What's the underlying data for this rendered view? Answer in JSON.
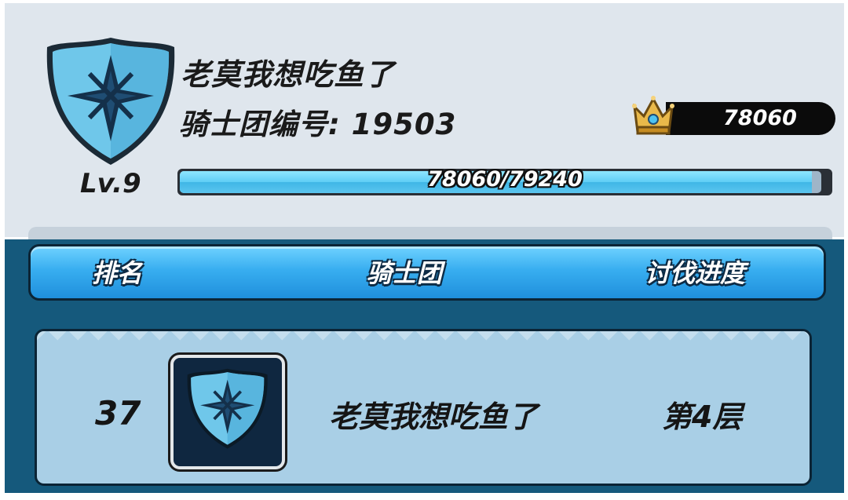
{
  "profile": {
    "guild_name": "老莫我想吃鱼了",
    "guild_id_label": "骑士团编号: 19503",
    "level": "Lv.9",
    "crown_score": "78060",
    "xp_text": "78060/79240",
    "xp_fraction": 0.985,
    "emblem_icon": "shield-star-icon"
  },
  "table": {
    "headers": {
      "rank": "排名",
      "guild": "骑士团",
      "progress": "讨伐进度"
    },
    "rows": [
      {
        "rank": "37",
        "name": "老莫我想吃鱼了",
        "progress": "第4层"
      }
    ]
  },
  "colors": {
    "accent_blue": "#38aef0",
    "panel_dark": "#15597c",
    "row_bg": "#a9cfe6"
  }
}
